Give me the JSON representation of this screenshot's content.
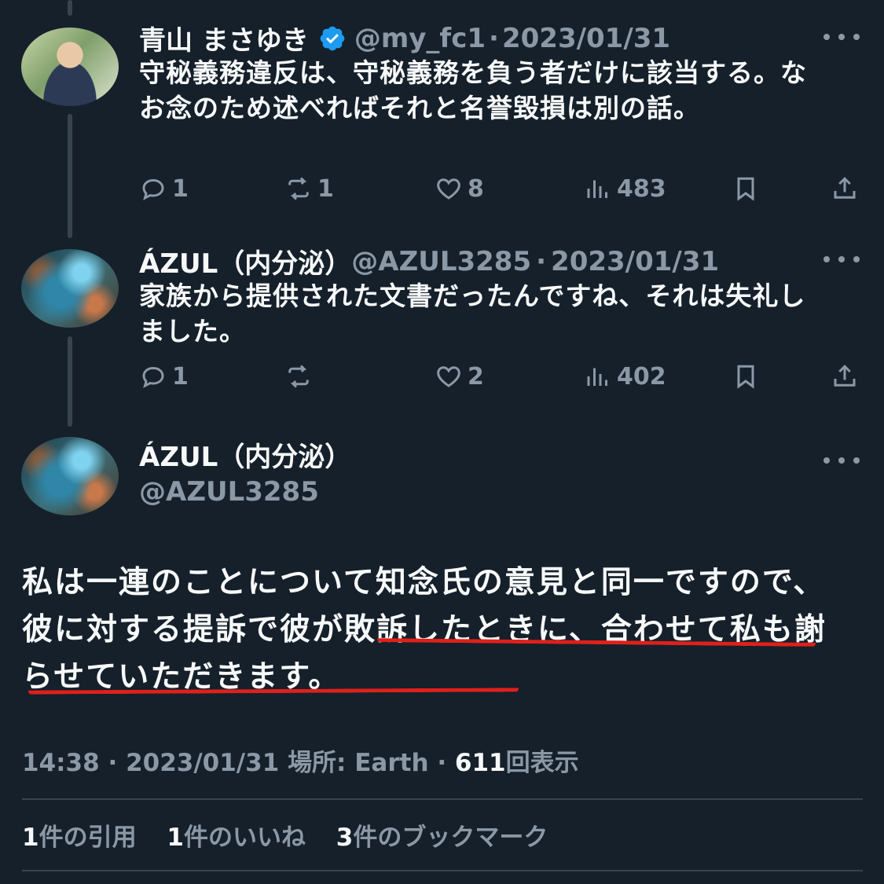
{
  "tweets": [
    {
      "author": "青山 まさゆき",
      "verified": true,
      "handle": "@my_fc1",
      "sep": "·",
      "date": "2023/01/31",
      "text": "守秘義務違反は、守秘義務を負う者だけに該当する。なお念のため述べればそれと名誉毀損は別の話。",
      "replies": "1",
      "retweets": "1",
      "likes": "8",
      "views": "483"
    },
    {
      "author": "ÁZUL（内分泌）",
      "verified": false,
      "handle": "@AZUL3285",
      "sep": "·",
      "date": "2023/01/31",
      "text": "家族から提供された文書だったんですね、それは失礼しました。",
      "replies": "1",
      "retweets": "",
      "likes": "2",
      "views": "402"
    }
  ],
  "main_tweet": {
    "author": "ÁZUL（内分泌）",
    "handle": "@AZUL3285",
    "text": "私は一連のことについて知念氏の意見と同一ですので、彼に対する提訴で彼が敗訴したときに、合わせて私も謝らせていただきます。",
    "time": "14:38",
    "date": "2023/01/31",
    "location_label": "場所: Earth",
    "views_count": "611",
    "views_label": "回表示",
    "sep": "·",
    "quotes_count": "1",
    "quotes_label": "件の引用",
    "likes_count": "1",
    "likes_label": "件のいいね",
    "bookmarks_count": "3",
    "bookmarks_label": "件のブックマーク"
  },
  "colors": {
    "background": "#15202b",
    "text": "#f7f9f9",
    "muted": "#8b98a5",
    "verified": "#1d9bf0",
    "annotation": "#e0201a"
  },
  "icons": [
    "reply-icon",
    "retweet-icon",
    "like-icon",
    "views-icon",
    "bookmark-icon",
    "share-icon",
    "more-icon",
    "verified-badge-icon"
  ]
}
